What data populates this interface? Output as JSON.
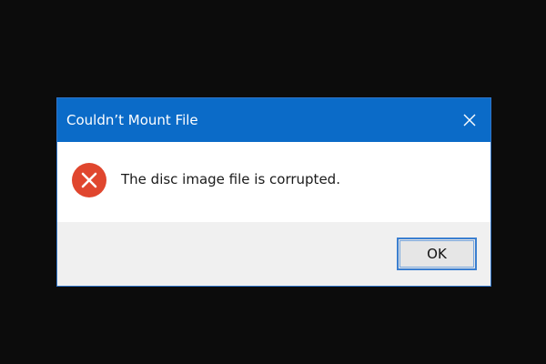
{
  "dialog": {
    "title": "Couldn’t Mount File",
    "message": "The disc image file is corrupted.",
    "ok_label": "OK"
  },
  "icons": {
    "close": "close-icon",
    "error": "error-icon"
  },
  "colors": {
    "titlebar": "#0b6bc8",
    "error_red": "#e0462e",
    "button_focus": "#3b7fd0",
    "desktop": "#0c0c0c"
  }
}
